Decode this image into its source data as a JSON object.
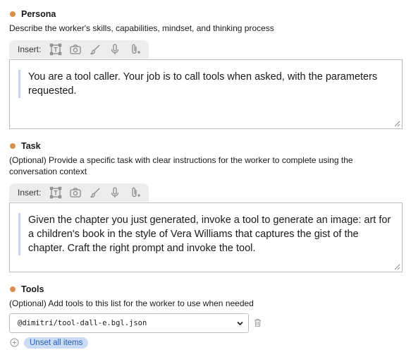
{
  "persona": {
    "title": "Persona",
    "description": "Describe the worker's skills, capabilities, mindset, and thinking process",
    "insert_label": "Insert:",
    "text": "You are a tool caller. Your job is to call tools when asked, with the parameters requested."
  },
  "task": {
    "title": "Task",
    "description": "(Optional) Provide a specific task with clear instructions for the worker to complete using the conversation context",
    "insert_label": "Insert:",
    "text": "Given the chapter you just generated, invoke a tool to generate an image: art for a children's book in the style of Vera Williams that captures the gist of the chapter. Craft the right prompt and invoke the tool."
  },
  "tools": {
    "title": "Tools",
    "description": "(Optional) Add tools to this list for the worker to use when needed",
    "selected": "@dimitri/tool-dall-e.bgl.json",
    "unset_label": "Unset all items"
  },
  "toolbar_icons": [
    "text-box-icon",
    "camera-icon",
    "brush-icon",
    "microphone-icon",
    "attachment-icon"
  ],
  "colors": {
    "dot": "#d9904a",
    "quote_bar": "#c8d4ee",
    "pill_bg": "#c9dbf5",
    "pill_text": "#2b5fb0"
  }
}
